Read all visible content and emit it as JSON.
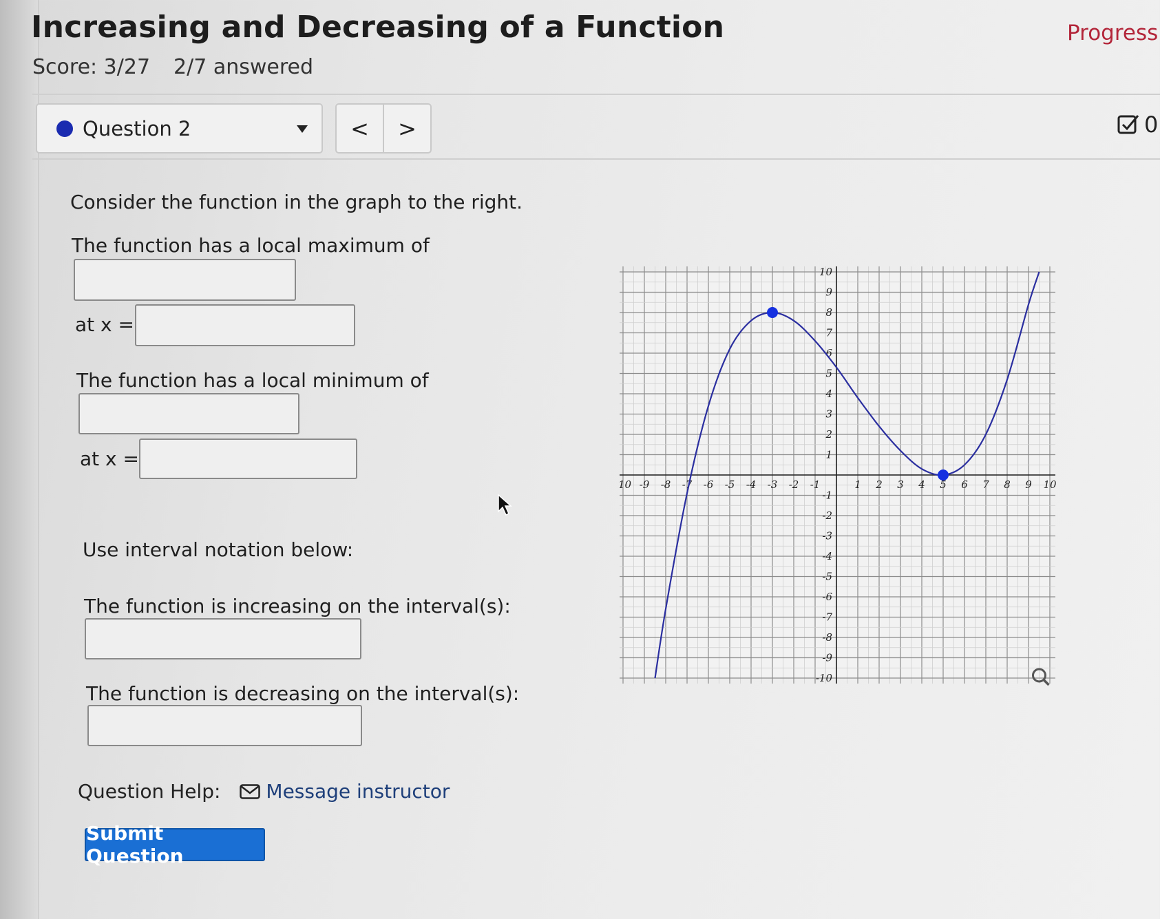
{
  "header": {
    "title": "Increasing and Decreasing of a Function",
    "progress_label": "Progress s",
    "score": "Score: 3/27",
    "answered": "2/7 answered"
  },
  "question_nav": {
    "selected": "Question 2",
    "prev_icon": "chevron-left-icon",
    "next_icon": "chevron-right-icon",
    "prev_glyph": "<",
    "next_glyph": ">",
    "attempt_value": "0."
  },
  "question": {
    "intro": "Consider the function in the graph to the right.",
    "max_prompt": "The function has a local maximum of",
    "max_at_label": "at x =",
    "min_prompt": "The function has a local minimum of",
    "min_at_label": "at x =",
    "interval_note": "Use interval notation below:",
    "increasing_prompt": "The function is increasing on the interval(s):",
    "decreasing_prompt": "The function is decreasing on the interval(s):",
    "inputs": {
      "local_max_value": "",
      "local_max_x": "",
      "local_min_value": "",
      "local_min_x": "",
      "increasing_intervals": "",
      "decreasing_intervals": ""
    }
  },
  "help": {
    "label": "Question Help:",
    "message_link": "Message instructor"
  },
  "submit_label": "Submit Question",
  "colors": {
    "accent_blue": "#1a6fd4",
    "curve": "#2b2fa0",
    "point": "#1530e0",
    "progress": "#b3263a"
  },
  "chart_data": {
    "type": "line",
    "x_ticks": [
      "-10",
      "-9",
      "-8",
      "-7",
      "-6",
      "-5",
      "-4",
      "-3",
      "-2",
      "-1",
      "1",
      "2",
      "3",
      "4",
      "5",
      "6",
      "7",
      "8",
      "9",
      "10"
    ],
    "y_ticks": [
      "10",
      "9",
      "8",
      "7",
      "6",
      "5",
      "4",
      "3",
      "2",
      "1",
      "-1",
      "-2",
      "-3",
      "-4",
      "-5",
      "-6",
      "-7",
      "-8",
      "-9",
      "-10"
    ],
    "xlim": [
      -10,
      10
    ],
    "ylim": [
      -10,
      10
    ],
    "grid": true,
    "series": [
      {
        "x": [
          -8.5,
          -8,
          -7,
          -6,
          -5,
          -4,
          -3,
          -2,
          -1,
          0,
          1,
          2,
          3,
          4,
          5,
          6,
          7,
          8,
          9,
          9.5
        ],
        "y": [
          -10,
          -6.6,
          -0.9,
          3.4,
          6.2,
          7.6,
          8,
          7.6,
          6.6,
          5.3,
          3.8,
          2.4,
          1.2,
          0.3,
          0,
          0.5,
          2,
          4.7,
          8.4,
          10
        ]
      }
    ],
    "points": [
      {
        "x": -3,
        "y": 8
      },
      {
        "x": 5,
        "y": 0
      }
    ]
  }
}
